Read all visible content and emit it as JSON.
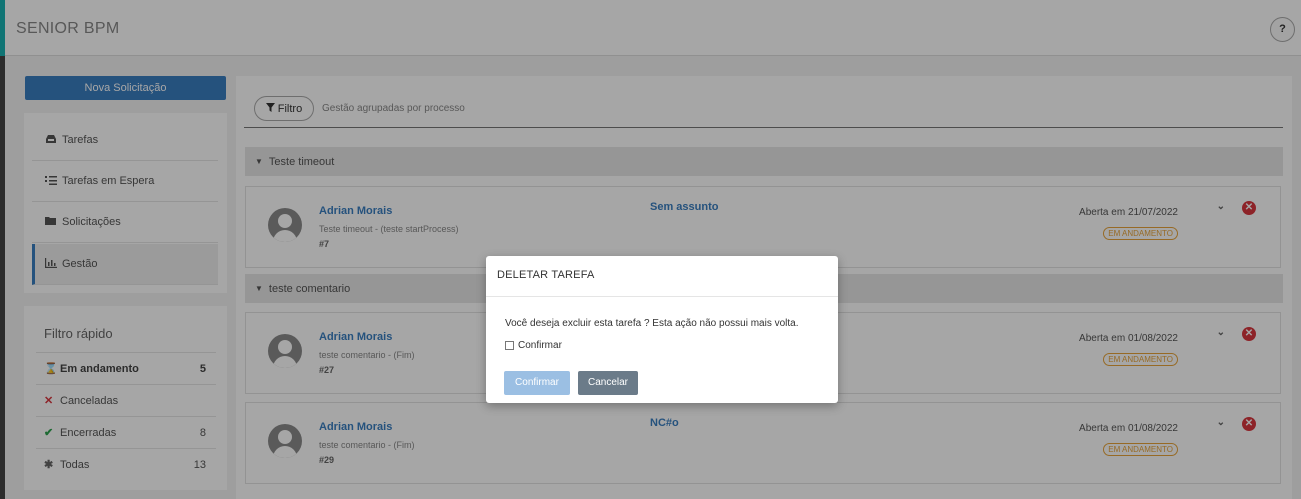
{
  "app": {
    "title": "SENIOR BPM",
    "help_label": "?"
  },
  "sidebar": {
    "new_request": "Nova Solicitação",
    "items": [
      {
        "label": "Tarefas",
        "icon": "inbox-icon"
      },
      {
        "label": "Tarefas em Espera",
        "icon": "task-list-icon"
      },
      {
        "label": "Solicitações",
        "icon": "folder-icon"
      },
      {
        "label": "Gestão",
        "icon": "bar-chart-icon"
      }
    ]
  },
  "quick_filter": {
    "title": "Filtro rápido",
    "rows": [
      {
        "label": "Em andamento",
        "count": "5",
        "icon": "hourglass-icon"
      },
      {
        "label": "Canceladas",
        "count": "",
        "icon": "cross-icon"
      },
      {
        "label": "Encerradas",
        "count": "8",
        "icon": "check-icon"
      },
      {
        "label": "Todas",
        "count": "13",
        "icon": "asterisk-icon"
      }
    ]
  },
  "filter": {
    "button": "Filtro",
    "description": "Gestão agrupadas por processo"
  },
  "groups": [
    {
      "name": "Teste timeout"
    },
    {
      "name": "teste comentario"
    }
  ],
  "tasks": [
    {
      "user": "Adrian Morais",
      "process": "Teste timeout - (teste startProcess)",
      "id": "#7",
      "subject": "Sem assunto",
      "date": "Aberta em 21/07/2022",
      "status": "EM ANDAMENTO"
    },
    {
      "user": "Adrian Morais",
      "process": "teste comentario - (Fim)",
      "id": "#27",
      "subject": "",
      "date": "Aberta em 01/08/2022",
      "status": "EM ANDAMENTO"
    },
    {
      "user": "Adrian Morais",
      "process": "teste comentario - (Fim)",
      "id": "#29",
      "subject": "NC#o",
      "date": "Aberta em 01/08/2022",
      "status": "EM ANDAMENTO"
    }
  ],
  "modal": {
    "title": "DELETAR TAREFA",
    "message": "Você deseja excluir esta tarefa ? Esta ação não possui mais volta.",
    "checkbox_label": "Confirmar",
    "confirm_label": "Confirmar",
    "cancel_label": "Cancelar"
  },
  "colors": {
    "primary": "#3a7ec1",
    "accent": "#1ab3b3",
    "status": "#e8a43a",
    "danger": "#d9363e"
  }
}
